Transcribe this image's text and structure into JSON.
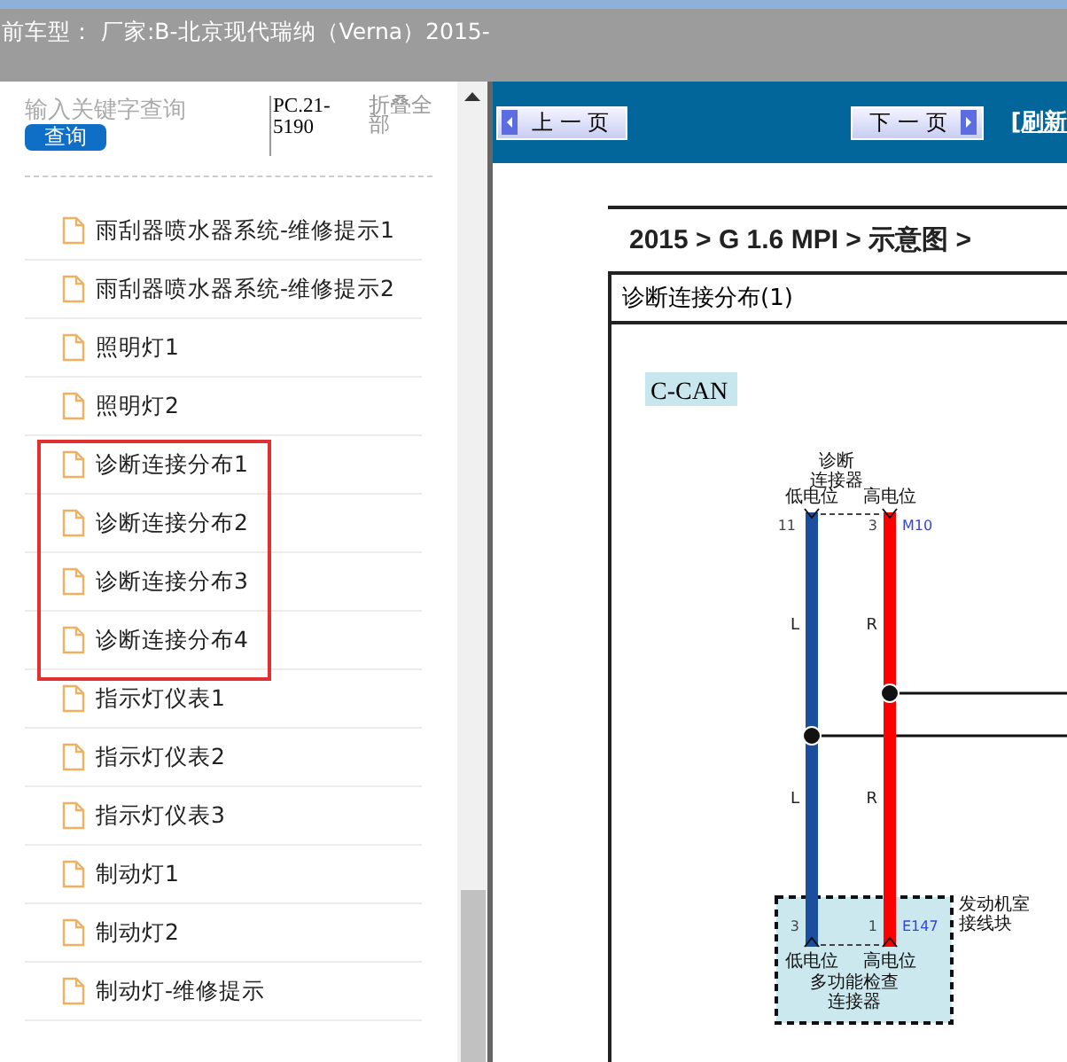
{
  "header": {
    "title": "前车型： 厂家:B-北京现代瑞纳（Verna）2015-"
  },
  "sidebar": {
    "search": {
      "placeholder": "输入关键字查询",
      "button": "查询"
    },
    "code": "PC.21-5190",
    "collapse_link": "折叠全部",
    "items": [
      {
        "label": "雨刮器喷水器系统-维修提示1",
        "highlighted": false
      },
      {
        "label": "雨刮器喷水器系统-维修提示2",
        "highlighted": false
      },
      {
        "label": "照明灯1",
        "highlighted": false
      },
      {
        "label": "照明灯2",
        "highlighted": false
      },
      {
        "label": "诊断连接分布1",
        "highlighted": true
      },
      {
        "label": "诊断连接分布2",
        "highlighted": true
      },
      {
        "label": "诊断连接分布3",
        "highlighted": true
      },
      {
        "label": "诊断连接分布4",
        "highlighted": true
      },
      {
        "label": "指示灯仪表1",
        "highlighted": false
      },
      {
        "label": "指示灯仪表2",
        "highlighted": false
      },
      {
        "label": "指示灯仪表3",
        "highlighted": false
      },
      {
        "label": "制动灯1",
        "highlighted": false
      },
      {
        "label": "制动灯2",
        "highlighted": false
      },
      {
        "label": "制动灯-维修提示",
        "highlighted": false
      }
    ]
  },
  "toolbar": {
    "prev_button": "上 一 页",
    "next_button": "下 一 页",
    "refresh_link": "[刷新"
  },
  "document": {
    "breadcrumb": "2015 > G 1.6 MPI > 示意图 >",
    "diagram_title": "诊断连接分布(1)",
    "diagram": {
      "bus_label": "C-CAN",
      "top_connector": {
        "name_lines": [
          "诊断",
          "连接器"
        ],
        "low_label": "低电位",
        "high_label": "高电位",
        "low_pin": "11",
        "high_pin": "3",
        "code": "M10"
      },
      "wires": [
        {
          "color": "#1c4e9e",
          "labels": [
            "L",
            "L"
          ]
        },
        {
          "color": "#ff0000",
          "labels": [
            "R",
            "R"
          ]
        }
      ],
      "bottom_connector": {
        "name_lines": [
          "多功能检查",
          "连接器"
        ],
        "low_label": "低电位",
        "high_label": "高电位",
        "low_pin": "3",
        "high_pin": "1",
        "code": "E147",
        "location_lines": [
          "发动机室",
          "接线块"
        ]
      }
    }
  }
}
